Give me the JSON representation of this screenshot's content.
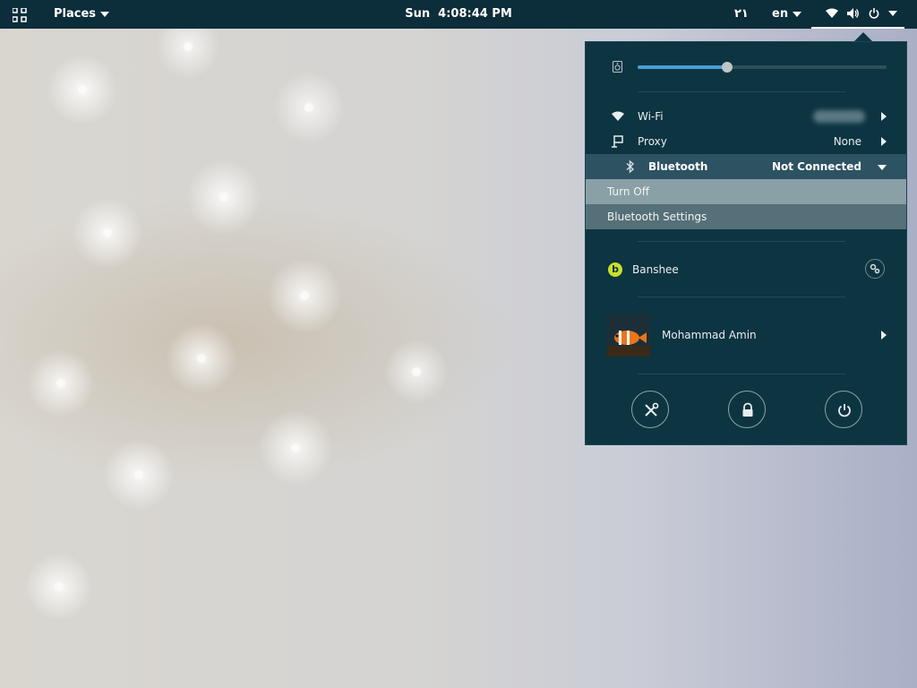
{
  "topbar": {
    "places_label": "Places",
    "day": "Sun",
    "time": "4:08:44 PM",
    "arabic_number": "۲۱",
    "language": "en"
  },
  "menu": {
    "volume_level_percent": 36,
    "wifi": {
      "label": "Wi-Fi"
    },
    "proxy": {
      "label": "Proxy",
      "value": "None"
    },
    "bluetooth": {
      "label": "Bluetooth",
      "status": "Not Connected"
    },
    "bluetooth_submenu": {
      "turn_off": "Turn Off",
      "settings": "Bluetooth Settings"
    },
    "media_player": {
      "label": "Banshee"
    },
    "user": {
      "name": "Mohammad Amin"
    },
    "actions": [
      "settings",
      "lock",
      "power"
    ]
  },
  "colors": {
    "topbar_bg": "#0c2d3a",
    "panel_bg": "#0d3441",
    "accent": "#4a9ed3",
    "banshee": "#c8e02a"
  }
}
